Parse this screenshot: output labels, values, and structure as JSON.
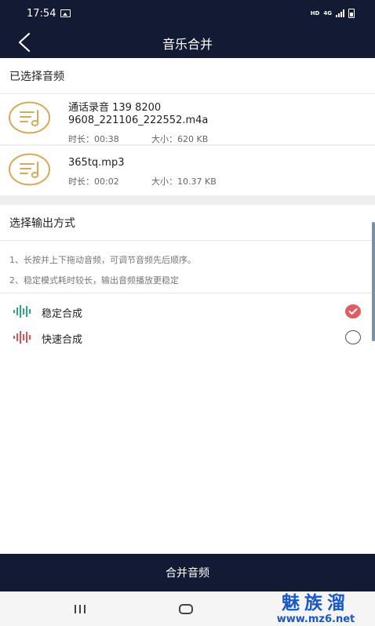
{
  "status_bar": {
    "time": "17:54",
    "hd_label": "HD",
    "network_label": "4G",
    "icons": [
      "image-icon",
      "signal-icon",
      "battery-icon"
    ]
  },
  "app_bar": {
    "title": "音乐合并",
    "back_icon": "back-chevron-icon"
  },
  "selected_section": {
    "title": "已选择音频",
    "files": [
      {
        "name_line1": "通话录音 139 8200",
        "name_line2": "9608_221106_222552.m4a",
        "duration": "时长：00:38",
        "size": "大小：620 KB",
        "icon": "music-note-icon"
      },
      {
        "name_line1": "365tq.mp3",
        "name_line2": "",
        "duration": "时长：00:02",
        "size": "大小：10.37 KB",
        "icon": "music-note-icon"
      }
    ]
  },
  "output_section": {
    "title": "选择输出方式",
    "tips": [
      "1、长按并上下拖动音频，可调节音频先后顺序。",
      "2、稳定模式耗时较长，输出音频播放更稳定"
    ],
    "modes": [
      {
        "label": "稳定合成",
        "selected": true,
        "wave_color": "#2fa58a"
      },
      {
        "label": "快速合成",
        "selected": false,
        "wave_color": "#d05a5a"
      }
    ]
  },
  "merge_button": {
    "label": "合并音频"
  },
  "watermark": {
    "text": "魅族溜",
    "url": "www.mz6.net"
  },
  "colors": {
    "header_bg": "#121b33",
    "accent_gold": "#d9a95b",
    "check_red": "#e05c63",
    "watermark_blue": "#1a57c8"
  }
}
